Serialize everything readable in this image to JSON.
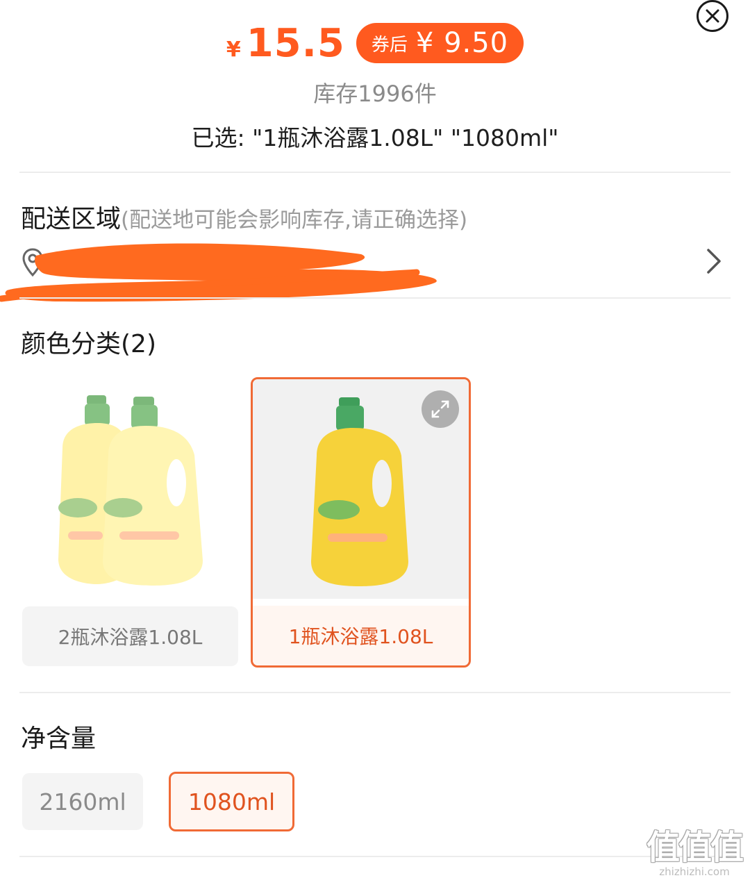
{
  "header": {
    "currency_symbol": "¥",
    "price": "15.5",
    "coupon_label": "券后",
    "coupon_price": "¥ 9.50",
    "stock": "库存1996件",
    "selected": "已选: \"1瓶沐浴露1.08L\" \"1080ml\""
  },
  "delivery": {
    "title": "配送区域",
    "hint": "(配送地可能会影响库存,请正确选择)",
    "address_visible": "…"
  },
  "color_category": {
    "title": "颜色分类(2)",
    "options": [
      {
        "label": "2瓶沐浴露1.08L",
        "selected": false
      },
      {
        "label": "1瓶沐浴露1.08L",
        "selected": true
      }
    ]
  },
  "volume": {
    "title": "净含量",
    "options": [
      {
        "label": "2160ml",
        "selected": false
      },
      {
        "label": "1080ml",
        "selected": true
      }
    ]
  },
  "watermark": {
    "main": "值值值",
    "sub": "zhizhizhi.com"
  },
  "colors": {
    "accent": "#ff5a1f",
    "selected_border": "#f06a35",
    "selected_text": "#e0531f",
    "muted_text": "#8a8a8a",
    "redaction": "#ff6a1f"
  },
  "icons": [
    "close-icon",
    "location-pin-icon",
    "chevron-right-icon",
    "expand-icon"
  ]
}
